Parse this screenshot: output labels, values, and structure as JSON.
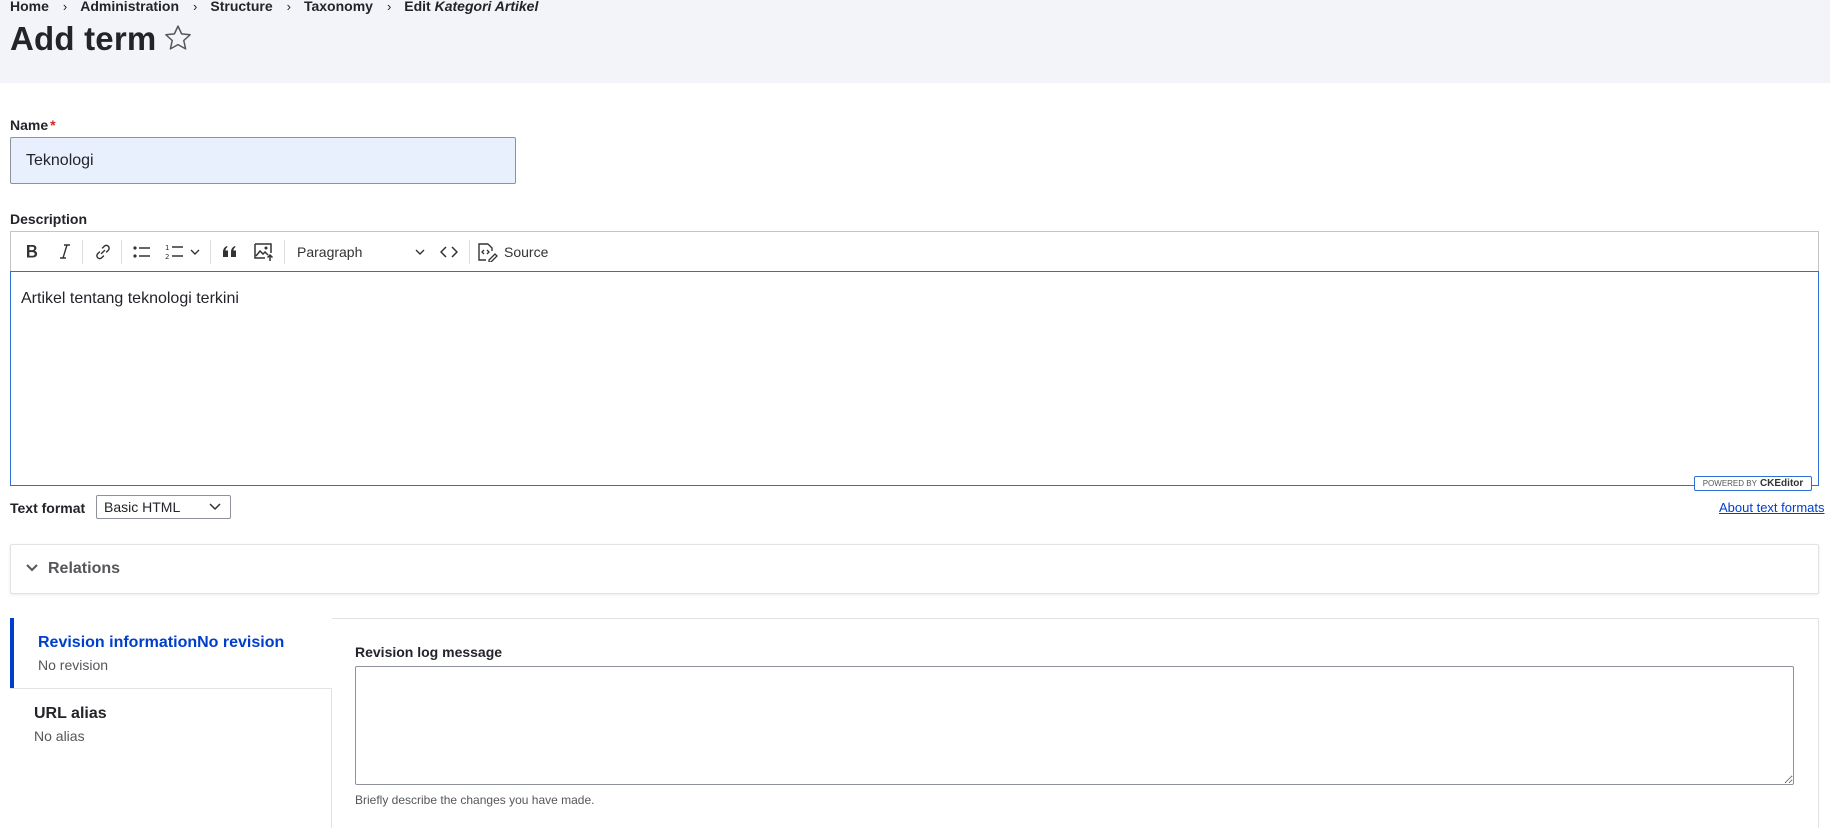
{
  "breadcrumb": {
    "items": [
      "Home",
      "Administration",
      "Structure",
      "Taxonomy"
    ],
    "current_prefix": "Edit ",
    "current_vocab": "Kategori Artikel"
  },
  "page": {
    "title": "Add term"
  },
  "name_field": {
    "label": "Name",
    "required_marker": "*",
    "value": "Teknologi"
  },
  "description": {
    "label": "Description",
    "toolbar": {
      "heading_select": "Paragraph",
      "source_label": "Source",
      "icons": [
        "bold-icon",
        "italic-icon",
        "link-icon",
        "bulleted-list-icon",
        "numbered-list-icon",
        "chevron-down-icon",
        "blockquote-icon",
        "image-upload-icon",
        "code-block-icon",
        "source-icon"
      ]
    },
    "content": "Artikel tentang teknologi terkini",
    "powered_by": "POWERED BY",
    "ckeditor_brand": "CKEditor"
  },
  "text_format": {
    "label": "Text format",
    "selected": "Basic HTML",
    "about_link": "About text formats"
  },
  "relations": {
    "label": "Relations"
  },
  "vertical_tabs": [
    {
      "title": "Revision informationNo revision",
      "summary": "No revision"
    },
    {
      "title": "URL alias",
      "summary": "No alias"
    }
  ],
  "revision": {
    "log_label": "Revision log message",
    "log_value": "",
    "help_text": "Briefly describe the changes you have made."
  },
  "colors": {
    "header_bg": "#f3f4f9",
    "link_blue": "#003ecc",
    "required_red": "#dc2323",
    "autofill_bg": "#e8f0fe",
    "focus_border": "#2f6fd3"
  }
}
